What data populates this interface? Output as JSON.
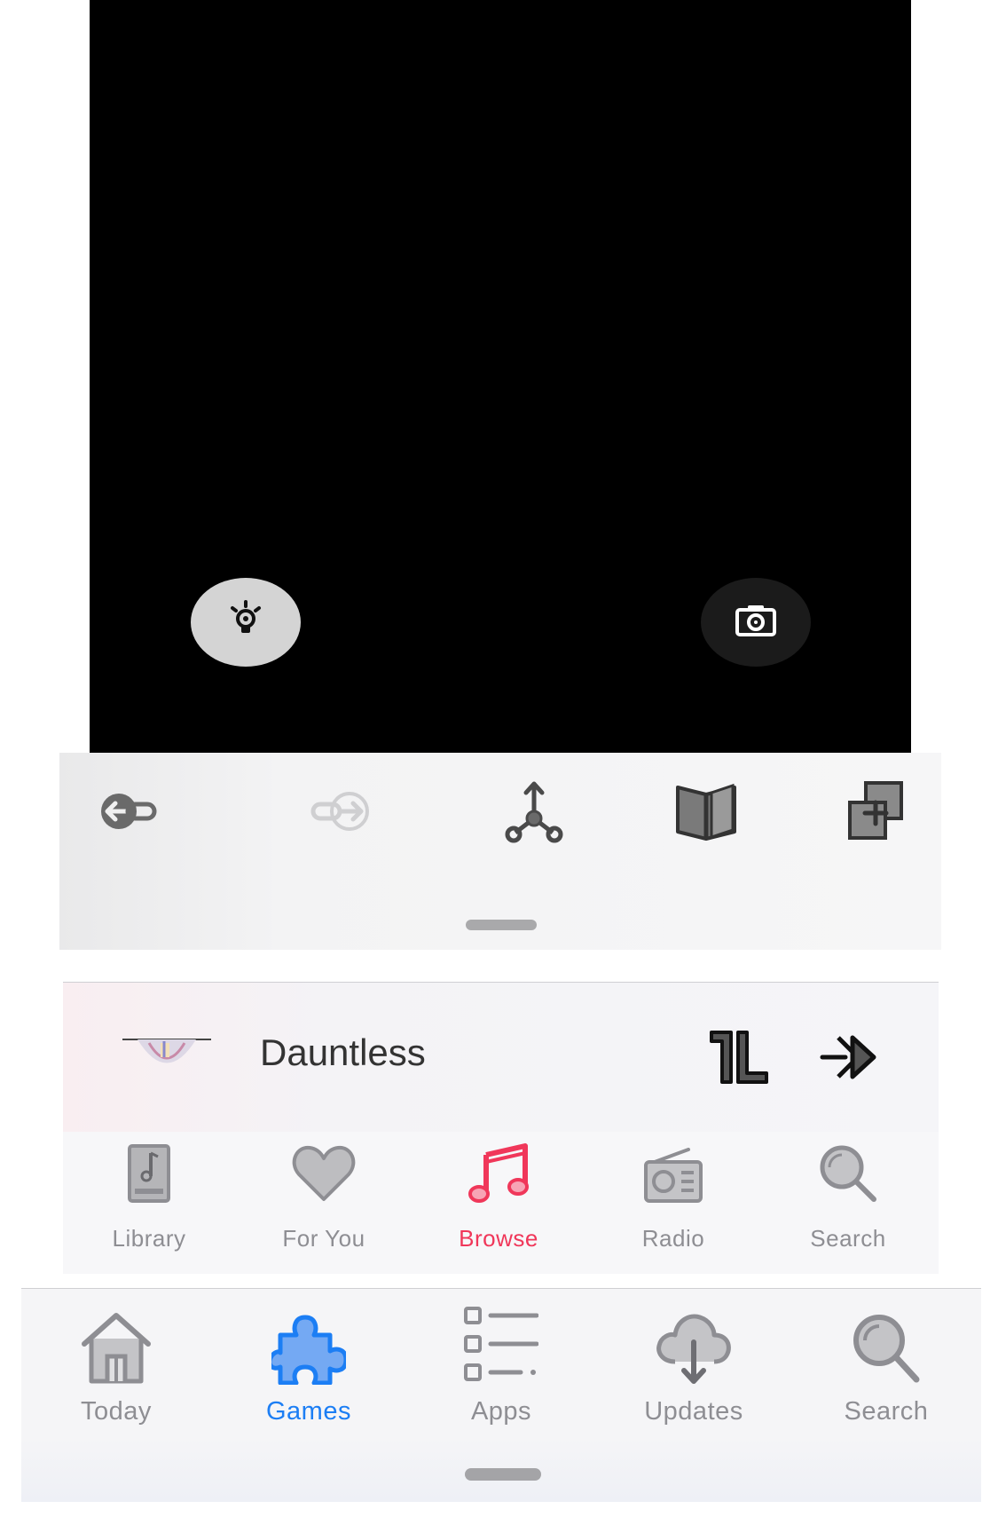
{
  "camera": {
    "flash_icon": "flashlight-icon",
    "capture_icon": "camera-icon"
  },
  "toolbar": {
    "icons": [
      "back-arrow-icon",
      "forward-arrow-icon",
      "share-icon",
      "bookmarks-icon",
      "tabs-icon"
    ]
  },
  "miniplayer": {
    "title": "Dauntless",
    "artwork_icon": "album-art",
    "pause_icon": "pause-icon",
    "skip_icon": "fast-forward-icon"
  },
  "music_tabs": [
    {
      "label": "Library",
      "icon": "library-icon",
      "selected": false
    },
    {
      "label": "For You",
      "icon": "heart-icon",
      "selected": false
    },
    {
      "label": "Browse",
      "icon": "music-note-icon",
      "selected": true
    },
    {
      "label": "Radio",
      "icon": "radio-icon",
      "selected": false
    },
    {
      "label": "Search",
      "icon": "search-icon",
      "selected": false
    }
  ],
  "store_tabs": [
    {
      "label": "Today",
      "icon": "home-icon",
      "selected": false
    },
    {
      "label": "Games",
      "icon": "puzzle-icon",
      "selected": true
    },
    {
      "label": "Apps",
      "icon": "list-icon",
      "selected": false
    },
    {
      "label": "Updates",
      "icon": "cloud-download-icon",
      "selected": false
    },
    {
      "label": "Search",
      "icon": "search-icon",
      "selected": false
    }
  ],
  "colors": {
    "music_accent": "#f0375a",
    "store_accent": "#1c7ef4",
    "inactive": "#8e8e93"
  }
}
